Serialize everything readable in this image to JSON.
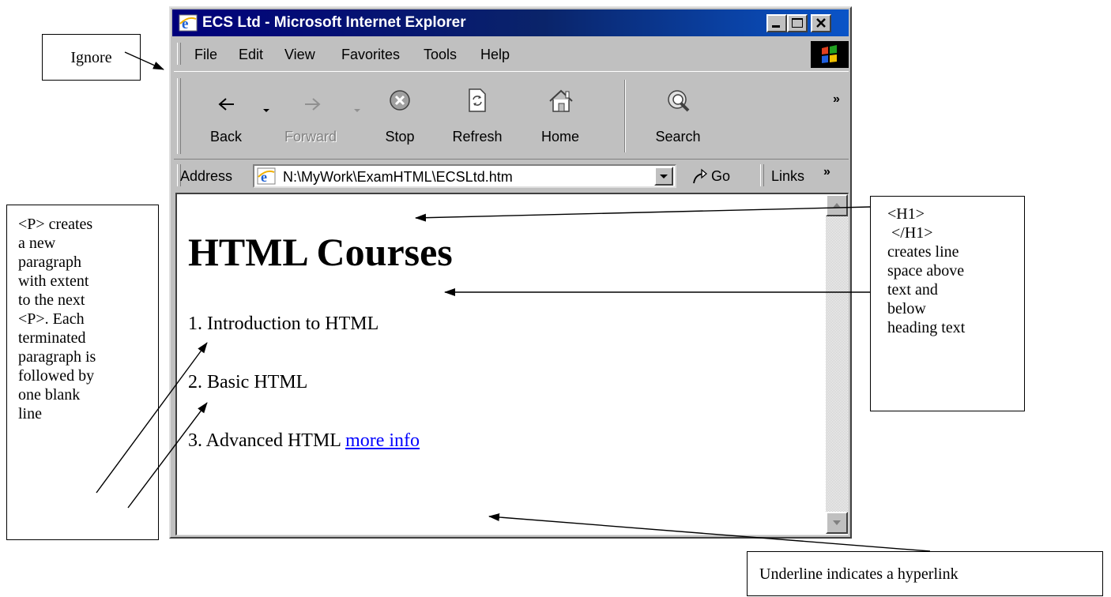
{
  "window": {
    "title": "ECS Ltd - Microsoft Internet Explorer"
  },
  "menu": [
    "File",
    "Edit",
    "View",
    "Favorites",
    "Tools",
    "Help"
  ],
  "toolbar": {
    "back": "Back",
    "forward": "Forward",
    "stop": "Stop",
    "refresh": "Refresh",
    "home": "Home",
    "search": "Search"
  },
  "address": {
    "label": "Address",
    "url": "N:\\MyWork\\ExamHTML\\ECSLtd.htm",
    "go": "Go",
    "links": "Links"
  },
  "page": {
    "heading": "HTML Courses",
    "items": [
      "1. Introduction to HTML",
      "2. Basic HTML",
      "3. Advanced HTML"
    ],
    "link_text": "more info"
  },
  "annotations": {
    "ignore": "Ignore",
    "p_tag": [
      "<P> creates",
      "a new",
      "paragraph",
      "with extent",
      "to the next",
      "<P>. Each",
      "terminated",
      "paragraph is",
      "followed by",
      "one blank",
      "line"
    ],
    "h1_tag": [
      "<H1>",
      " </H1>",
      "creates line",
      "space above",
      "text and",
      "below",
      "heading text"
    ],
    "hyperlink": "Underline indicates a hyperlink"
  }
}
